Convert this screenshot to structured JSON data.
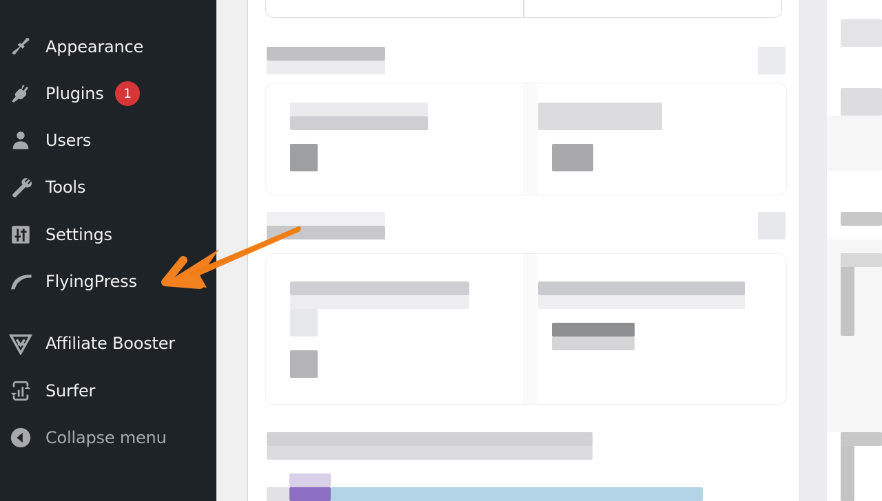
{
  "sidebar": {
    "items": [
      {
        "label": "Appearance",
        "icon": "paintbrush-icon"
      },
      {
        "label": "Plugins",
        "icon": "plugin-icon",
        "badge": "1"
      },
      {
        "label": "Users",
        "icon": "user-icon"
      },
      {
        "label": "Tools",
        "icon": "wrench-icon"
      },
      {
        "label": "Settings",
        "icon": "settings-sliders-icon"
      },
      {
        "label": "FlyingPress",
        "icon": "flyingpress-wing-icon"
      },
      {
        "label": "Affiliate Booster",
        "icon": "affiliate-booster-logo-icon"
      },
      {
        "label": "Surfer",
        "icon": "surfer-chart-icon"
      },
      {
        "label": "Collapse menu",
        "icon": "collapse-arrow-icon"
      }
    ]
  },
  "annotation": {
    "type": "arrow",
    "color": "#f48120",
    "points_to": "FlyingPress"
  },
  "colors": {
    "sidebar_bg": "#1d2327",
    "badge": "#d63638",
    "menu_text": "#f0f0f1",
    "icon": "#a7aaad"
  }
}
